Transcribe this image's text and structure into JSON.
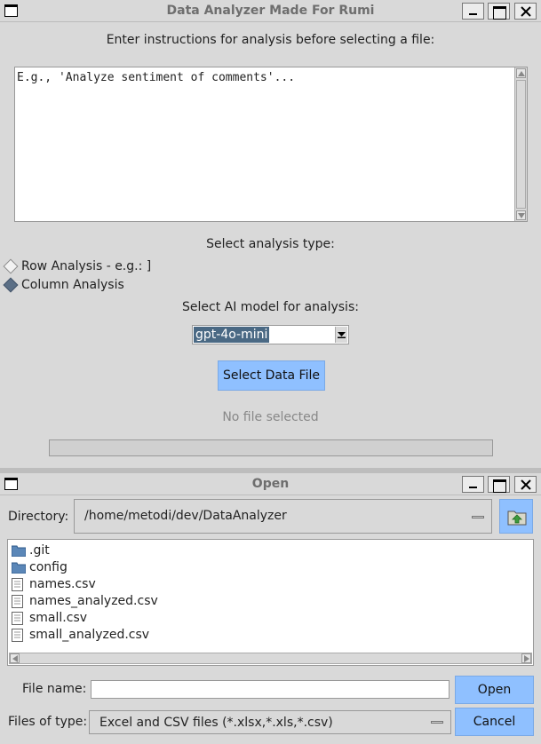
{
  "analyzer": {
    "window_title": "Data Analyzer Made For Rumi",
    "instructions_label": "Enter instructions for analysis before selecting a file:",
    "instructions_text": "E.g., 'Analyze sentiment of comments'...",
    "analysis_type_label": "Select analysis type:",
    "options": [
      {
        "label": "Row Analysis - e.g.:  ]",
        "selected": false
      },
      {
        "label": "Column Analysis",
        "selected": true
      }
    ],
    "model_label": "Select AI model for analysis:",
    "model_selected": "gpt-4o-mini",
    "select_file_button": "Select Data File",
    "status": "No file selected",
    "progress": 0
  },
  "open_dialog": {
    "window_title": "Open",
    "directory_label": "Directory:",
    "directory_value": "/home/metodi/dev/DataAnalyzer",
    "files": [
      {
        "name": ".git",
        "kind": "folder"
      },
      {
        "name": "config",
        "kind": "folder"
      },
      {
        "name": "names.csv",
        "kind": "file"
      },
      {
        "name": "names_analyzed.csv",
        "kind": "file"
      },
      {
        "name": "small.csv",
        "kind": "file"
      },
      {
        "name": "small_analyzed.csv",
        "kind": "file"
      }
    ],
    "file_name_label": "File name:",
    "file_name_value": "",
    "files_of_type_label": "Files of type:",
    "files_of_type_value": "Excel and CSV files (*.xlsx,*.xls,*.csv)",
    "open_button": "Open",
    "cancel_button": "Cancel"
  },
  "colors": {
    "background": "#d9d9d9",
    "accent_button": "#8fc0ff",
    "selection": "#4a6984"
  }
}
